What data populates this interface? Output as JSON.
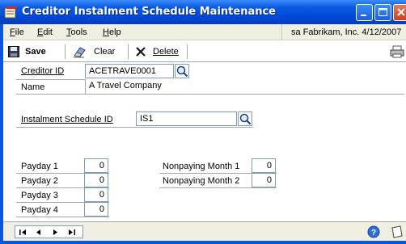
{
  "window": {
    "title": "Creditor Instalment Schedule Maintenance"
  },
  "menu": {
    "items": [
      {
        "key": "F",
        "rest": "ile"
      },
      {
        "key": "E",
        "rest": "dit"
      },
      {
        "key": "T",
        "rest": "ools"
      },
      {
        "key": "H",
        "rest": "elp"
      }
    ],
    "session": "sa  Fabrikam, Inc.  4/12/2007"
  },
  "toolbar": {
    "save_label": "Save",
    "clear_label": "Clear",
    "delete_label": "Delete"
  },
  "form": {
    "creditor_id_label": "Creditor ID",
    "creditor_id_value": "ACETRAVE0001",
    "name_label": "Name",
    "name_value": "A Travel Company",
    "schedule_id_label": "Instalment Schedule ID",
    "schedule_id_value": "IS1",
    "paydays": [
      {
        "label": "Payday 1",
        "value": "0"
      },
      {
        "label": "Payday 2",
        "value": "0"
      },
      {
        "label": "Payday 3",
        "value": "0"
      },
      {
        "label": "Payday 4",
        "value": "0"
      }
    ],
    "nonpaying": [
      {
        "label": "Nonpaying Month 1",
        "value": "0"
      },
      {
        "label": "Nonpaying Month 2",
        "value": "0"
      }
    ]
  },
  "colors": {
    "title_bar": "#0a57de",
    "chrome": "#f1efe2",
    "field_border": "#7f9db9"
  }
}
